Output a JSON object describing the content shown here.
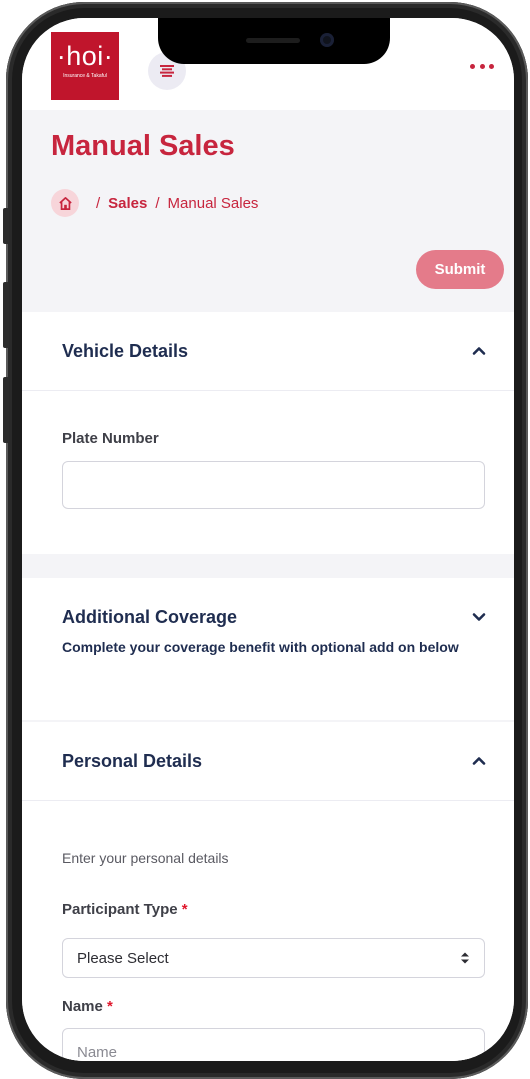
{
  "brand": {
    "logo_word": "·hoi·",
    "logo_sub": "Insurance & Takaful",
    "accent": "#c7253e",
    "navy": "#1f2d50"
  },
  "header": {
    "menu_icon": "hamburger-icon",
    "more_icon": "more-dots-icon"
  },
  "page": {
    "title": "Manual Sales",
    "breadcrumb": {
      "home_icon": "home-icon",
      "sep": "/",
      "section": "Sales",
      "current": "Manual Sales"
    },
    "submit_label": "Submit"
  },
  "vehicle": {
    "title": "Vehicle Details",
    "toggle_icon": "chevron-up-icon",
    "plate_label": "Plate Number",
    "plate_value": ""
  },
  "coverage": {
    "title": "Additional Coverage",
    "toggle_icon": "chevron-down-icon",
    "description": "Complete your coverage benefit with optional add on below"
  },
  "personal": {
    "title": "Personal Details",
    "toggle_icon": "chevron-up-icon",
    "intro": "Enter your personal details",
    "participant_label": "Participant Type",
    "participant_required": "*",
    "participant_value": "Please Select",
    "name_label": "Name",
    "name_required": "*",
    "name_placeholder": "Name"
  }
}
